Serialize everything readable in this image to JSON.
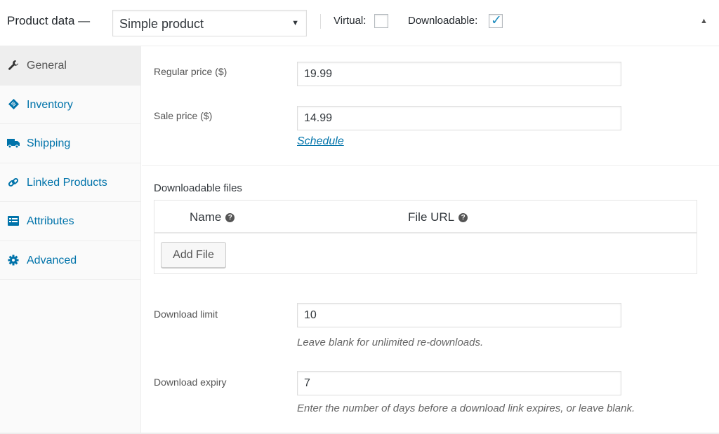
{
  "header": {
    "title": "Product data —",
    "product_type": "Simple product",
    "virtual_label": "Virtual:",
    "virtual_checked": false,
    "downloadable_label": "Downloadable:",
    "downloadable_checked": true,
    "collapse_icon": "triangle-up"
  },
  "sidebar": {
    "items": [
      {
        "label": "General",
        "icon": "wrench-icon",
        "active": true
      },
      {
        "label": "Inventory",
        "icon": "tag-icon",
        "active": false
      },
      {
        "label": "Shipping",
        "icon": "truck-icon",
        "active": false
      },
      {
        "label": "Linked Products",
        "icon": "link-icon",
        "active": false
      },
      {
        "label": "Attributes",
        "icon": "list-card-icon",
        "active": false
      },
      {
        "label": "Advanced",
        "icon": "gear-icon",
        "active": false
      }
    ]
  },
  "general": {
    "regular_price_label": "Regular price ($)",
    "regular_price_value": "19.99",
    "sale_price_label": "Sale price ($)",
    "sale_price_value": "14.99",
    "schedule_link": "Schedule"
  },
  "downloads": {
    "title": "Downloadable files",
    "columns": [
      "Name",
      "File URL"
    ],
    "help_glyph": "?",
    "add_file_label": "Add File",
    "download_limit_label": "Download limit",
    "download_limit_value": "10",
    "download_limit_desc": "Leave blank for unlimited re-downloads.",
    "download_expiry_label": "Download expiry",
    "download_expiry_value": "7",
    "download_expiry_desc": "Enter the number of days before a download link expires, or leave blank."
  },
  "colors": {
    "accent": "#0073aa",
    "check": "#1e8cbe"
  }
}
